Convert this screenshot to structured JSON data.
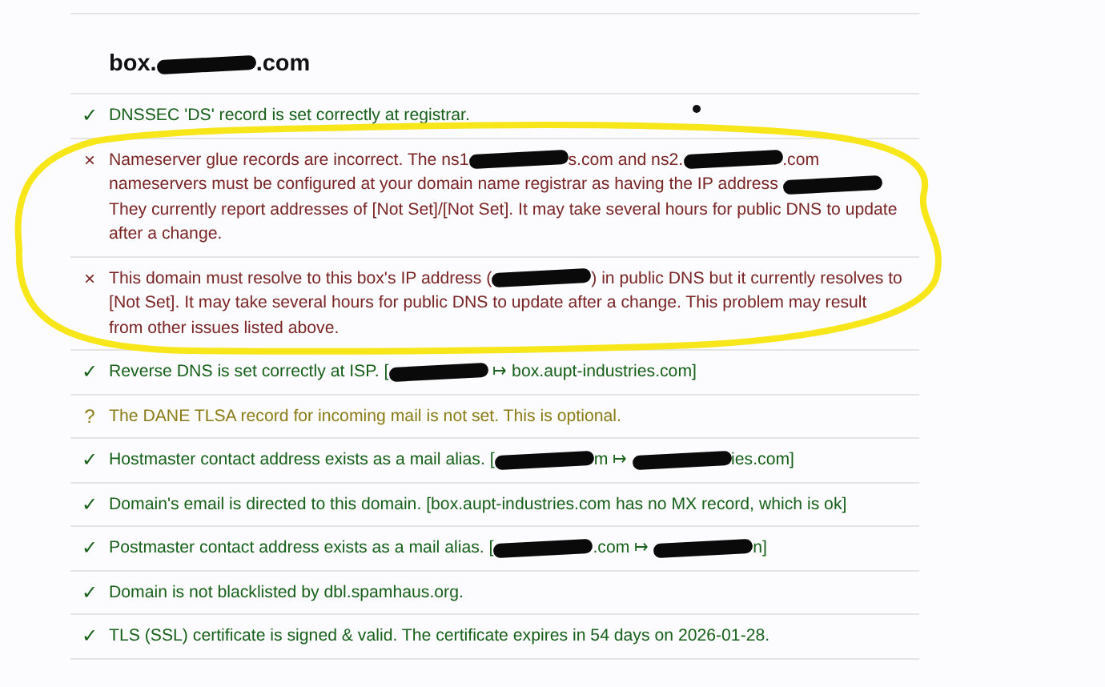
{
  "heading": {
    "parts": [
      {
        "kind": "text",
        "text": "box."
      },
      {
        "kind": "redaction"
      },
      {
        "kind": "text",
        "text": ".com"
      }
    ]
  },
  "checks": [
    {
      "kind": "ok",
      "icon": "✓",
      "parts": [
        {
          "kind": "text",
          "text": "DNSSEC 'DS' record is set correctly at registrar."
        }
      ]
    },
    {
      "kind": "error",
      "icon": "×",
      "parts": [
        {
          "kind": "text",
          "text": "Nameserver glue records are incorrect. The ns1"
        },
        {
          "kind": "redaction"
        },
        {
          "kind": "text",
          "text": "s.com and ns2."
        },
        {
          "kind": "redaction"
        },
        {
          "kind": "text",
          "text": ".com nameservers must be configured at your domain name registrar as having the IP address "
        },
        {
          "kind": "redaction"
        },
        {
          "kind": "text",
          "text": " They currently report addresses of [Not Set]/[Not Set]. It may take several hours for public DNS to update after a change."
        }
      ]
    },
    {
      "kind": "error",
      "icon": "×",
      "parts": [
        {
          "kind": "text",
          "text": "This domain must resolve to this box's IP address ("
        },
        {
          "kind": "redaction"
        },
        {
          "kind": "text",
          "text": ") in public DNS but it currently resolves to [Not Set]. It may take several hours for public DNS to update after a change. This problem may result from other issues listed above."
        }
      ]
    },
    {
      "kind": "ok",
      "icon": "✓",
      "parts": [
        {
          "kind": "text",
          "text": "Reverse DNS is set correctly at ISP. ["
        },
        {
          "kind": "redaction"
        },
        {
          "kind": "text",
          "text": " ↦ box.aupt-industries.com]"
        }
      ]
    },
    {
      "kind": "warning",
      "icon": "?",
      "parts": [
        {
          "kind": "text",
          "text": "The DANE TLSA record for incoming mail is not set. This is optional."
        }
      ]
    },
    {
      "kind": "ok",
      "icon": "✓",
      "parts": [
        {
          "kind": "text",
          "text": "Hostmaster contact address exists as a mail alias. ["
        },
        {
          "kind": "redaction"
        },
        {
          "kind": "text",
          "text": "m ↦ "
        },
        {
          "kind": "redaction"
        },
        {
          "kind": "text",
          "text": "ies.com]"
        }
      ]
    },
    {
      "kind": "ok",
      "icon": "✓",
      "parts": [
        {
          "kind": "text",
          "text": "Domain's email is directed to this domain. [box.aupt-industries.com has no MX record, which is ok]"
        }
      ]
    },
    {
      "kind": "ok",
      "icon": "✓",
      "parts": [
        {
          "kind": "text",
          "text": "Postmaster contact address exists as a mail alias. ["
        },
        {
          "kind": "redaction"
        },
        {
          "kind": "text",
          "text": ".com ↦ "
        },
        {
          "kind": "redaction"
        },
        {
          "kind": "text",
          "text": "n]"
        }
      ]
    },
    {
      "kind": "ok",
      "icon": "✓",
      "parts": [
        {
          "kind": "text",
          "text": "Domain is not blacklisted by dbl.spamhaus.org."
        }
      ]
    },
    {
      "kind": "ok",
      "icon": "✓",
      "parts": [
        {
          "kind": "text",
          "text": "TLS (SSL) certificate is signed & valid. The certificate expires in 54 days on 2026-01-28."
        }
      ]
    }
  ]
}
